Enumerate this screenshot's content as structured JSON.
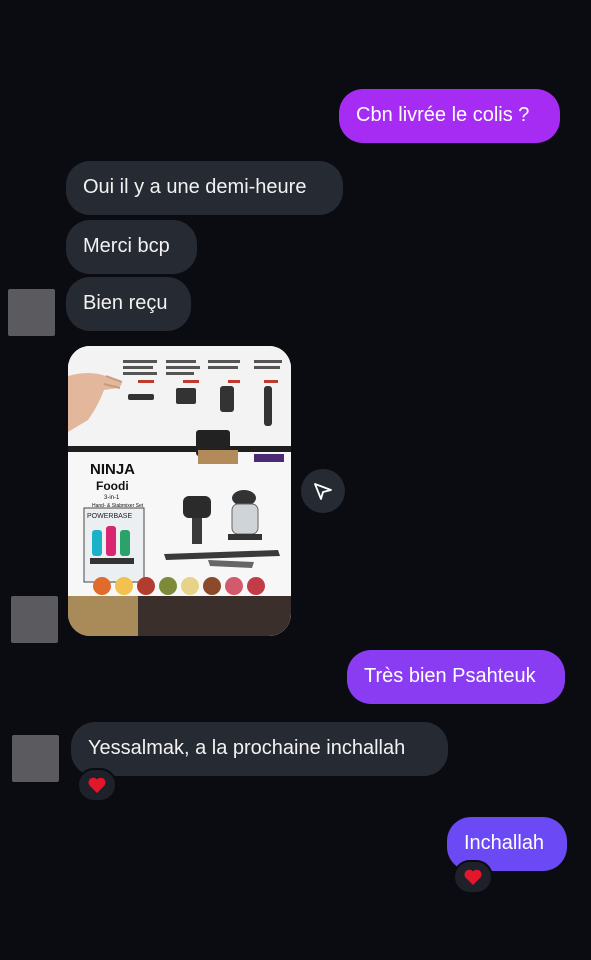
{
  "messages": [
    {
      "text": "Cbn livrée le colis ?"
    },
    {
      "text": "Oui il y a une demi-heure"
    },
    {
      "text": "Merci bcp"
    },
    {
      "text": "Bien reçu"
    },
    {
      "text": "Très bien Psahteuk"
    },
    {
      "text": "Yessalmak, a la prochaine inchallah"
    },
    {
      "text": "Inchallah"
    }
  ],
  "photo": {
    "brand": "NINJA",
    "product": "Foodi",
    "tagline": "3-in-1",
    "subtitle": "Hand- & Stabmixer Set",
    "badge": "POWERBASE"
  },
  "reactions": {
    "emoji": "heart-icon"
  },
  "colors": {
    "background": "#0b0b12",
    "incoming_bubble": "#262a33",
    "outgoing_top": "#a62cf3",
    "outgoing_mid": "#8a3cf3",
    "outgoing_bottom": "#6b49f4",
    "heart": "#e3162c"
  }
}
